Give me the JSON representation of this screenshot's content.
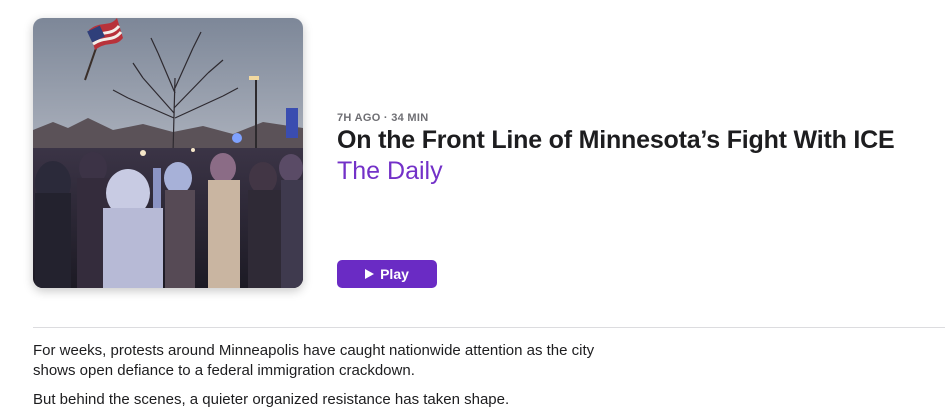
{
  "episode": {
    "meta": "7H AGO · 34 MIN",
    "title": "On the Front Line of Minnesota’s Fight With ICE",
    "show": "The Daily",
    "play_label": "Play",
    "artwork_icon": "protest-photo-artwork"
  },
  "description": {
    "paragraphs": [
      "For weeks, protests around Minneapolis have caught nationwide attention as the city shows open defiance to a federal immigration crackdown.",
      "But behind the scenes, a quieter organized resistance has taken shape."
    ]
  },
  "colors": {
    "accent": "#7331c8",
    "button": "#6a2bc4",
    "meta_text": "#6e6e73"
  }
}
